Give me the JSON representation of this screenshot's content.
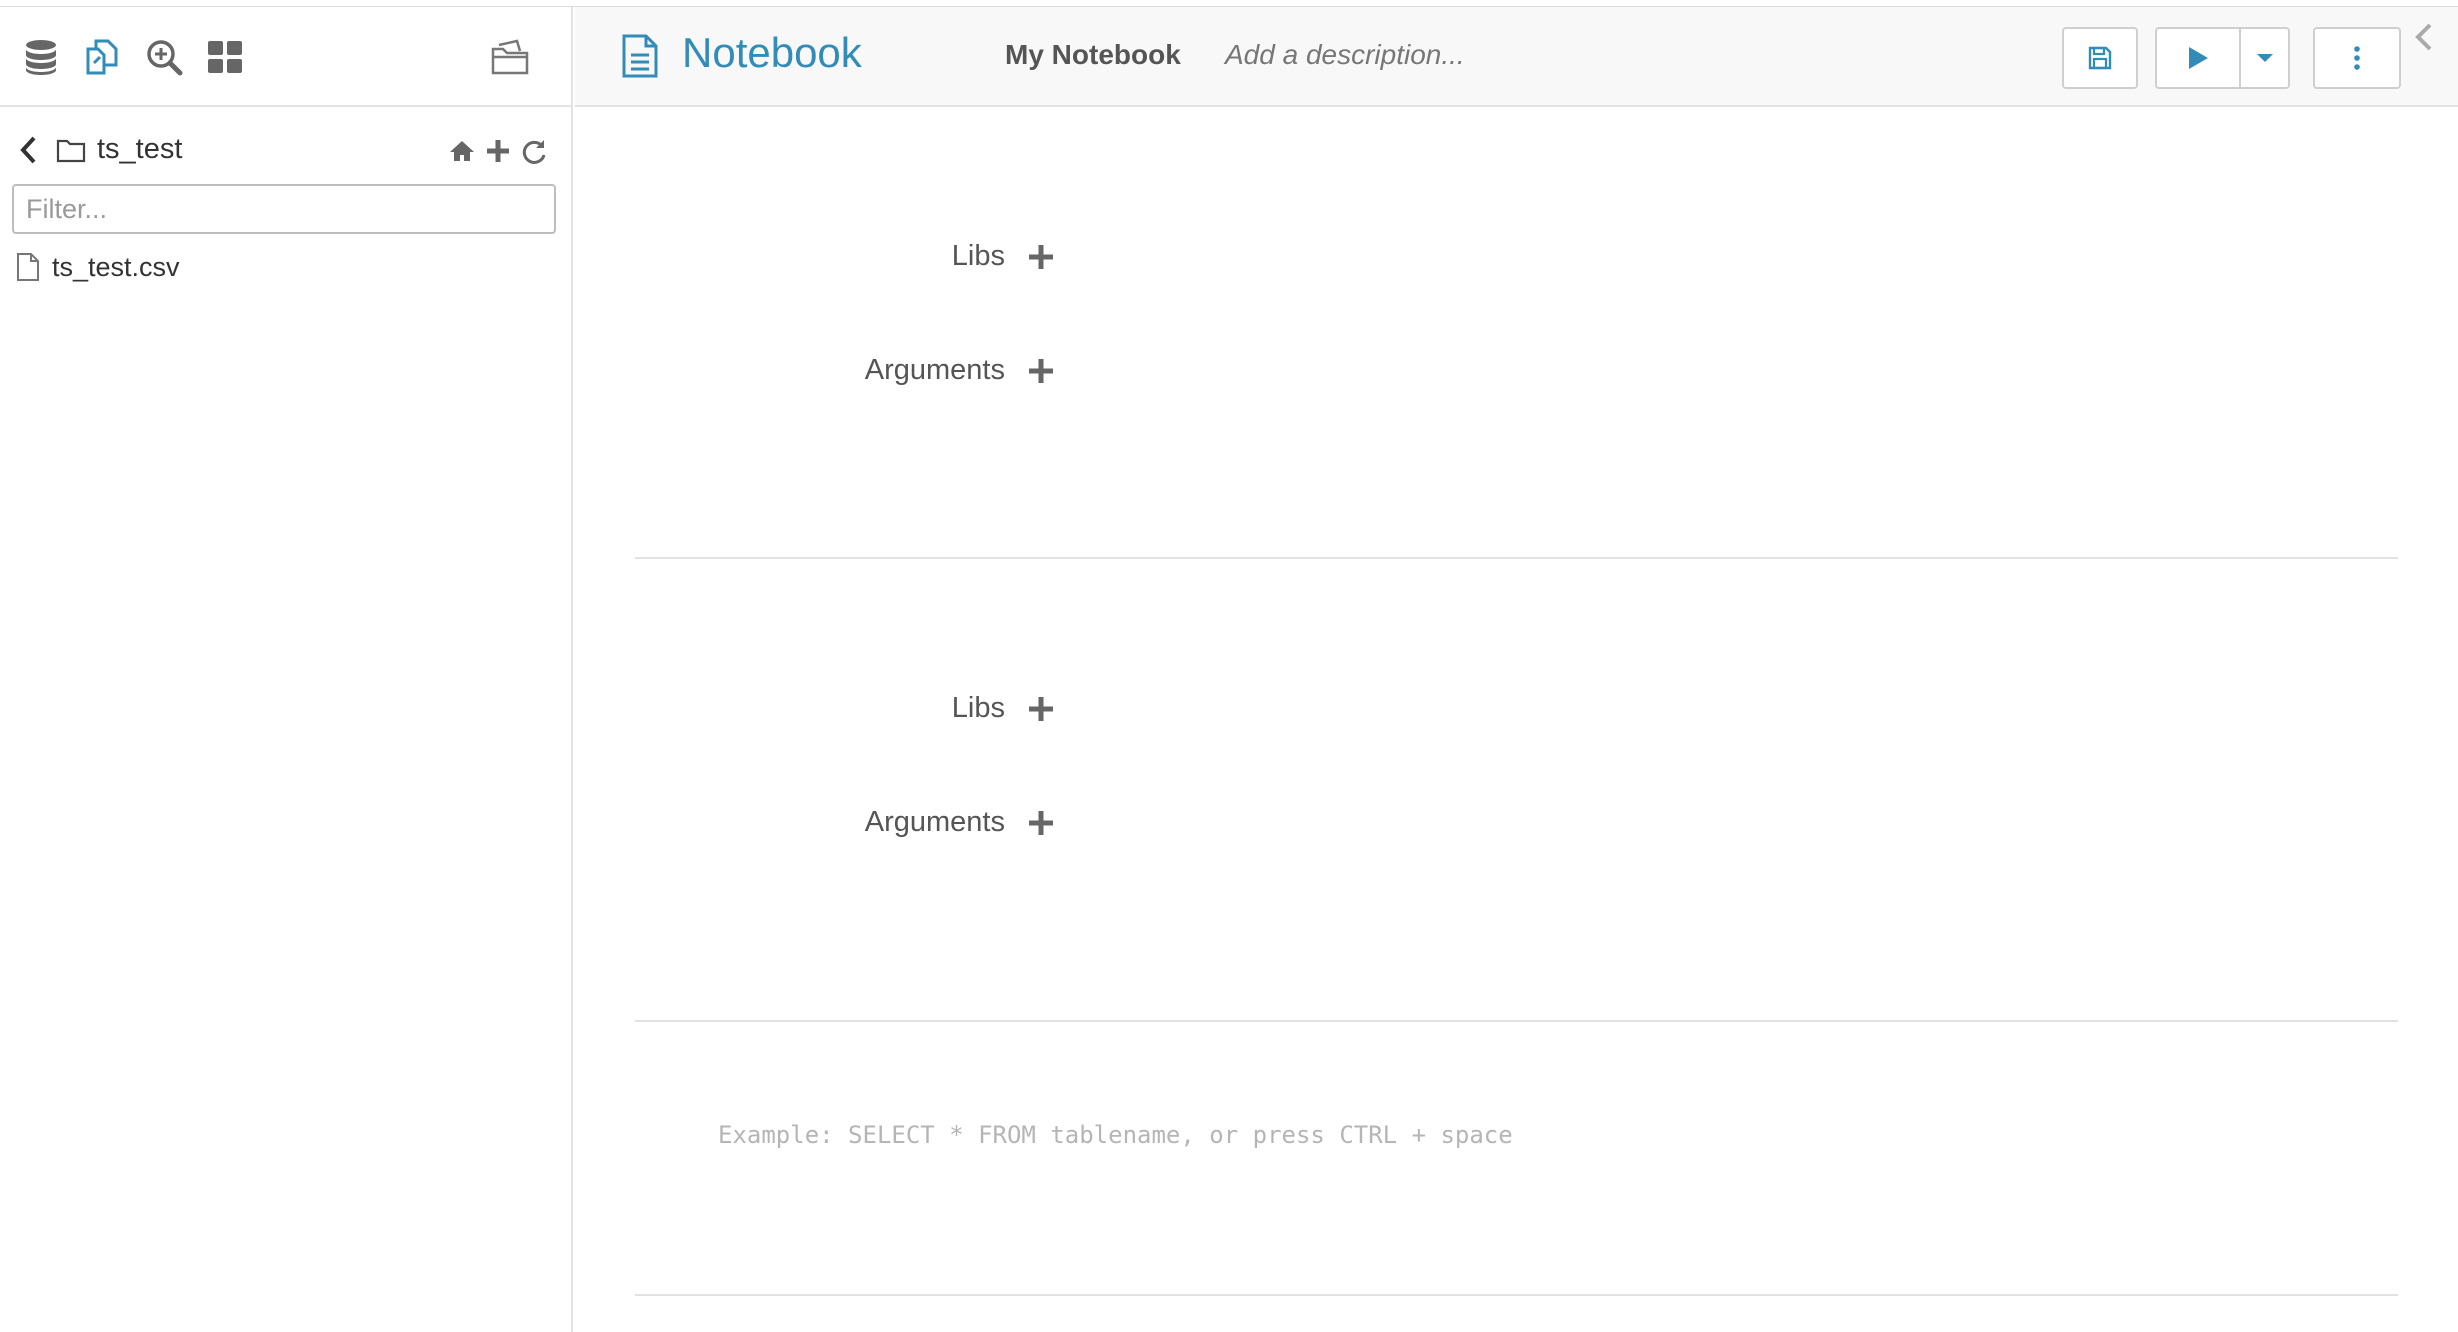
{
  "sidebar": {
    "top_icons": [
      {
        "name": "database-icon"
      },
      {
        "name": "documents-icon"
      },
      {
        "name": "search-zoom-icon"
      },
      {
        "name": "grid-icon"
      }
    ],
    "files_icon": "open-folder-icon",
    "path": {
      "current_folder": "ts_test"
    },
    "filter": {
      "placeholder": "Filter..."
    },
    "files": [
      {
        "name": "ts_test.csv"
      }
    ]
  },
  "header": {
    "title": "Notebook",
    "notebook_name": "My Notebook",
    "description_placeholder": "Add a description..."
  },
  "snippets": [
    {
      "libs_label": "Libs",
      "arguments_label": "Arguments"
    },
    {
      "libs_label": "Libs",
      "arguments_label": "Arguments"
    }
  ],
  "editor": {
    "placeholder": "Example: SELECT * FROM tablename, or press CTRL + space"
  },
  "colors": {
    "accent": "#338bb8",
    "icon_gray": "#555555",
    "divider": "#e2e2e2"
  }
}
